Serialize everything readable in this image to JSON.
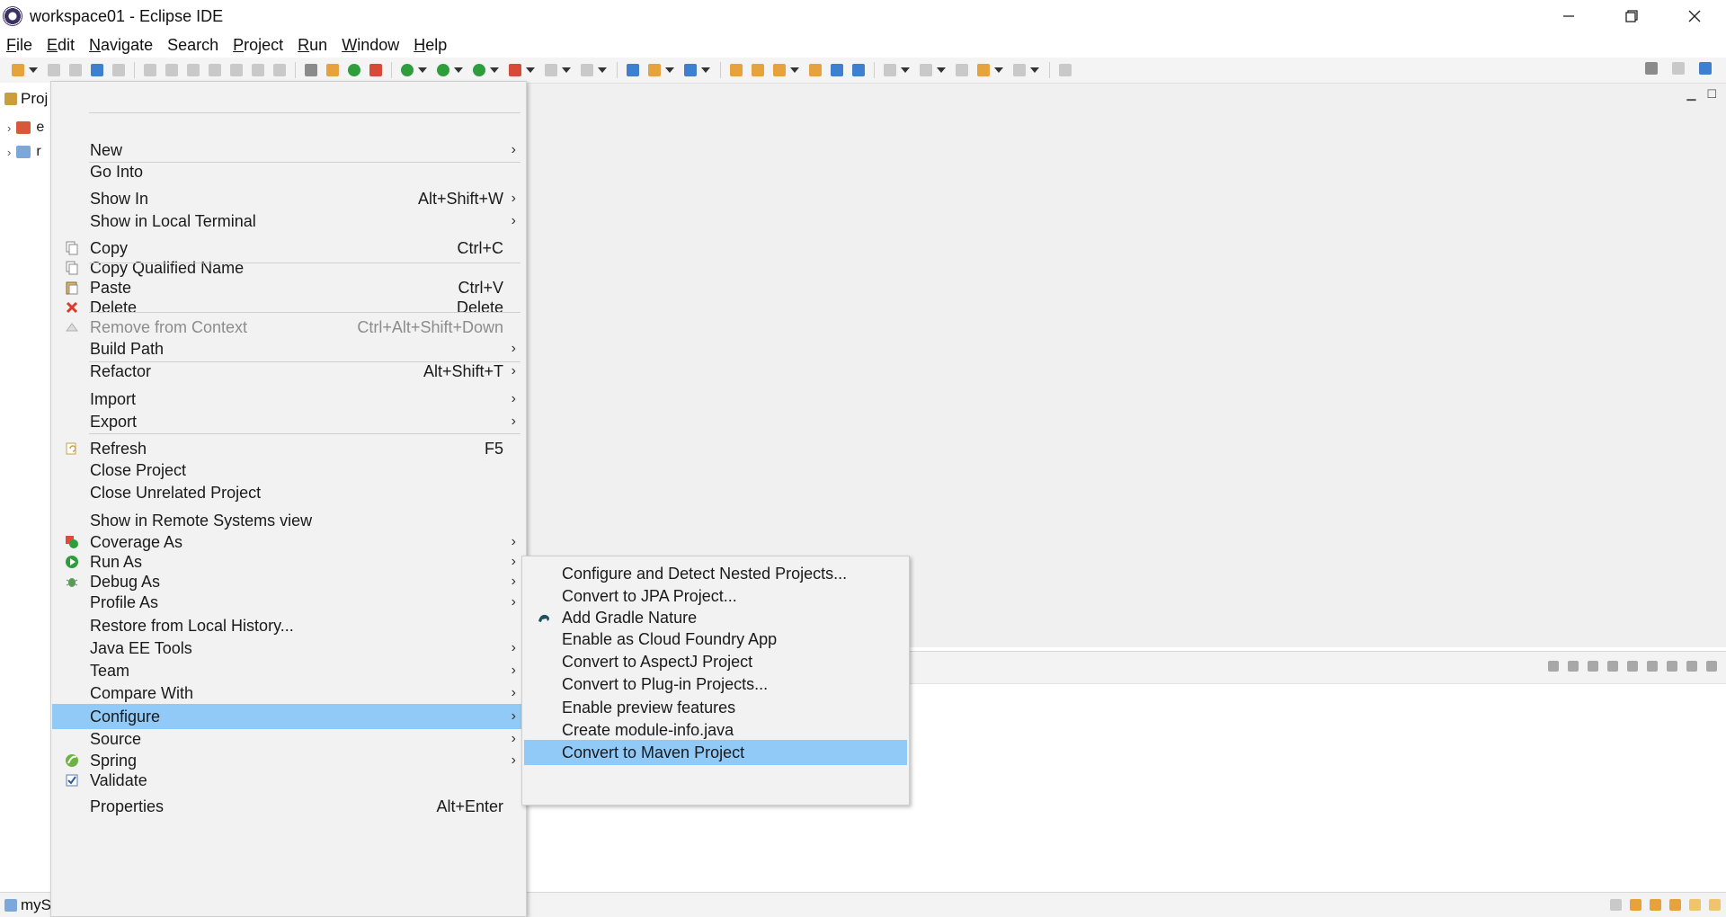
{
  "window": {
    "title": "workspace01 - Eclipse IDE",
    "minimize": "—",
    "restore": "❐",
    "close": "✕"
  },
  "menubar": [
    {
      "label": "File",
      "u": "F",
      "rest": "ile"
    },
    {
      "label": "Edit",
      "u": "E",
      "rest": "dit"
    },
    {
      "label": "Navigate",
      "u": "N",
      "rest": "avigate"
    },
    {
      "label": "Search",
      "u": "",
      "rest": "Search"
    },
    {
      "label": "Project",
      "u": "P",
      "rest": "roject"
    },
    {
      "label": "Run",
      "u": "R",
      "rest": "un"
    },
    {
      "label": "Window",
      "u": "W",
      "rest": "indow"
    },
    {
      "label": "Help",
      "u": "H",
      "rest": "elp"
    }
  ],
  "left_panel": {
    "tab_label": "Proj",
    "tree": [
      {
        "label": "e"
      },
      {
        "label": "r"
      }
    ]
  },
  "statusbar": {
    "text": "myS"
  },
  "context_menu": {
    "items": [
      {
        "label": "New",
        "shortcut": "",
        "arrow": "›",
        "icon": ""
      },
      {
        "label": "Go Into",
        "shortcut": "",
        "arrow": "",
        "icon": ""
      },
      {
        "label": "Show In",
        "shortcut": "Alt+Shift+W",
        "arrow": "›",
        "icon": ""
      },
      {
        "label": "Show in Local Terminal",
        "shortcut": "",
        "arrow": "›",
        "icon": ""
      },
      {
        "label": "Copy",
        "shortcut": "Ctrl+C",
        "arrow": "",
        "icon": "copy-icon"
      },
      {
        "label": "Copy Qualified Name",
        "shortcut": "",
        "arrow": "",
        "icon": "copy-qualified-icon"
      },
      {
        "label": "Paste",
        "shortcut": "Ctrl+V",
        "arrow": "",
        "icon": "paste-icon"
      },
      {
        "label": "Delete",
        "shortcut": "Delete",
        "arrow": "",
        "icon": "delete-icon"
      },
      {
        "label": "Remove from Context",
        "shortcut": "Ctrl+Alt+Shift+Down",
        "arrow": "",
        "icon": "remove-context-icon",
        "disabled": true
      },
      {
        "label": "Build Path",
        "shortcut": "",
        "arrow": "›",
        "icon": ""
      },
      {
        "label": "Refactor",
        "shortcut": "Alt+Shift+T",
        "arrow": "›",
        "icon": ""
      },
      {
        "label": "Import",
        "shortcut": "",
        "arrow": "›",
        "icon": ""
      },
      {
        "label": "Export",
        "shortcut": "",
        "arrow": "›",
        "icon": ""
      },
      {
        "label": "Refresh",
        "shortcut": "F5",
        "arrow": "",
        "icon": "refresh-icon"
      },
      {
        "label": "Close Project",
        "shortcut": "",
        "arrow": "",
        "icon": ""
      },
      {
        "label": "Close Unrelated Project",
        "shortcut": "",
        "arrow": "",
        "icon": ""
      },
      {
        "label": "Show in Remote Systems view",
        "shortcut": "",
        "arrow": "",
        "icon": ""
      },
      {
        "label": "Coverage As",
        "shortcut": "",
        "arrow": "›",
        "icon": "coverage-icon"
      },
      {
        "label": "Run As",
        "shortcut": "",
        "arrow": "›",
        "icon": "run-icon"
      },
      {
        "label": "Debug As",
        "shortcut": "",
        "arrow": "›",
        "icon": "debug-icon"
      },
      {
        "label": "Profile As",
        "shortcut": "",
        "arrow": "›",
        "icon": ""
      },
      {
        "label": "Restore from Local History...",
        "shortcut": "",
        "arrow": "",
        "icon": ""
      },
      {
        "label": "Java EE Tools",
        "shortcut": "",
        "arrow": "›",
        "icon": ""
      },
      {
        "label": "Team",
        "shortcut": "",
        "arrow": "›",
        "icon": ""
      },
      {
        "label": "Compare With",
        "shortcut": "",
        "arrow": "›",
        "icon": ""
      },
      {
        "label": "Configure",
        "shortcut": "",
        "arrow": "›",
        "icon": "",
        "selected": true
      },
      {
        "label": "Source",
        "shortcut": "",
        "arrow": "›",
        "icon": ""
      },
      {
        "label": "Spring",
        "shortcut": "",
        "arrow": "›",
        "icon": "spring-icon"
      },
      {
        "label": "Validate",
        "shortcut": "",
        "arrow": "",
        "icon": "validate-icon"
      },
      {
        "label": "Properties",
        "shortcut": "Alt+Enter",
        "arrow": "",
        "icon": ""
      }
    ]
  },
  "submenu": {
    "items": [
      {
        "label": "Configure and Detect Nested Projects...",
        "icon": ""
      },
      {
        "label": "Convert to JPA Project...",
        "icon": ""
      },
      {
        "label": "Add Gradle Nature",
        "icon": "gradle-icon"
      },
      {
        "label": "Enable as Cloud Foundry App",
        "icon": ""
      },
      {
        "label": "Convert to AspectJ Project",
        "icon": ""
      },
      {
        "label": "Convert to Plug-in Projects...",
        "icon": ""
      },
      {
        "label": "Enable preview features",
        "icon": ""
      },
      {
        "label": "Create module-info.java",
        "icon": ""
      },
      {
        "label": "Convert to Maven Project",
        "icon": "",
        "selected": true
      }
    ]
  },
  "colors": {
    "selection": "#91c9f7",
    "menu_bg": "#f2f2f2",
    "disabled_text": "#8c8c8c"
  }
}
